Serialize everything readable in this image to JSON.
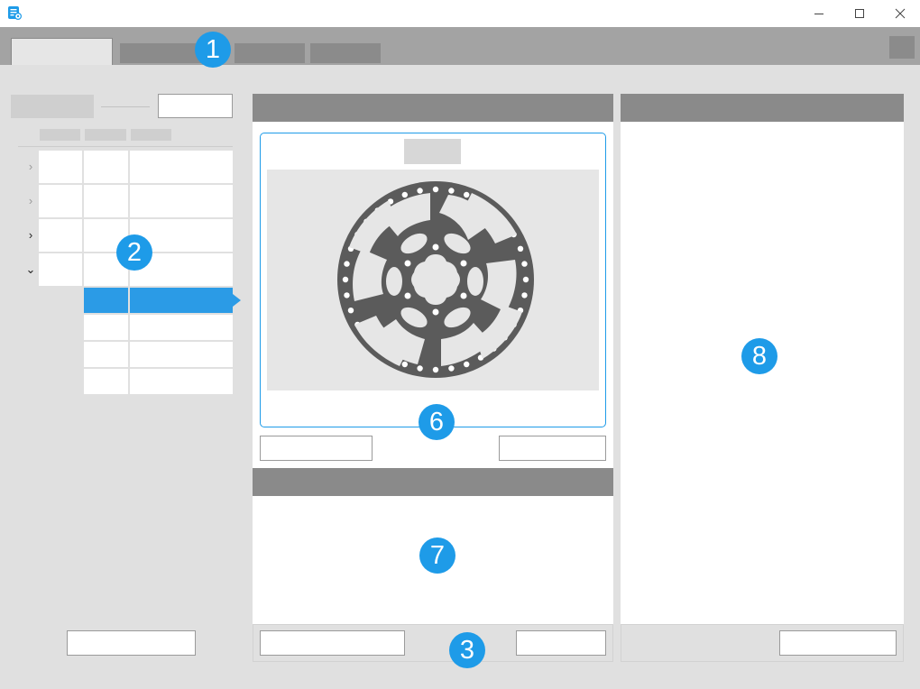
{
  "window": {
    "icon": "app-document-icon",
    "controls": [
      "minimize-icon",
      "maximize-icon",
      "close-icon"
    ]
  },
  "tabs": [
    {
      "label": "",
      "active": true
    },
    {
      "label": "",
      "active": false
    },
    {
      "label": "",
      "active": false
    },
    {
      "label": "",
      "active": false
    }
  ],
  "callouts": [
    "1",
    "2",
    "3",
    "6",
    "7",
    "8"
  ],
  "preview": {
    "image": "brake-disc-rotor-image"
  },
  "colors": {
    "accent": "#1e9be8",
    "selected_row": "#2b9be6",
    "tab_bar": "#a3a3a3",
    "panel_header": "#8a8a8a",
    "background": "#e0e0e0"
  }
}
